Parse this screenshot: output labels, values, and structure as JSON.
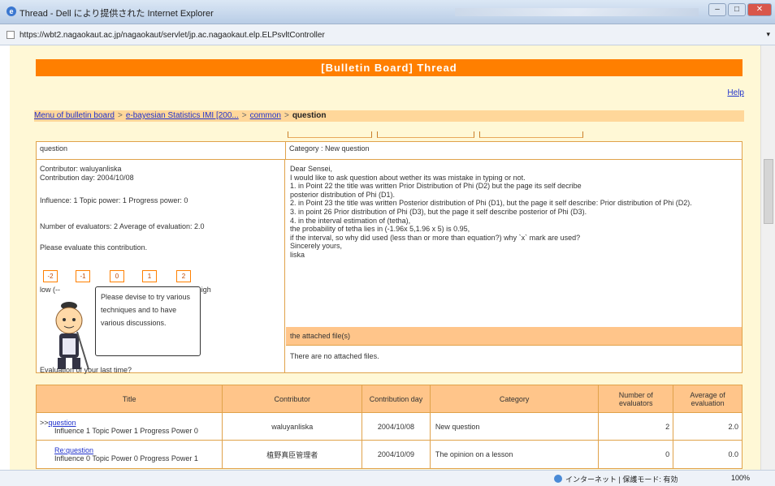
{
  "window": {
    "title": "Thread - Dell により提供された Internet Explorer",
    "url": "https://wbt2.nagaokaut.ac.jp/nagaokaut/servlet/jp.ac.nagaokaut.elp.ELPsvltController"
  },
  "banner": "[Bulletin Board] Thread",
  "help": "Help",
  "breadcrumb": {
    "items": [
      "Menu of bulletin board",
      "e-bayesian Statistics IMI [200...",
      "common"
    ],
    "current": "question"
  },
  "post": {
    "title": "question",
    "category": "Category : New question",
    "contributor": "Contributor: waluyanliska",
    "day": "Contribution day: 2004/10/08",
    "influence": "Influence: 1    Topic power: 1 Progress power: 0",
    "evaluators": "Number of evaluators: 2    Average of evaluation: 2.0",
    "evaluate_prompt": "Please evaluate this contribution.",
    "eval_buttons": [
      "-2",
      "-1",
      "0",
      "1",
      "2"
    ],
    "low": "low (--",
    "high": "--> high",
    "tip": "Please devise to try various techniques and to have various discussions.",
    "last_time": "Evaluation of your last time?",
    "body": [
      "Dear Sensei,",
      "I would like to ask question about wether its was mistake in typing or not.",
      "1. in Point 22 the title was written Prior Distribution of Phi (D2) but the page its self decribe",
      "posterior distribution of Phi (D1).",
      "2. in Point 23 the title was written Posterior distribution of Phi (D1), but the page it self describe: Prior distribution of Phi (D2).",
      "3. in point 26 Prior distribution of Phi (D3), but the page it self describe posterior of Phi (D3).",
      "4. in the interval estimation of (tetha),",
      "the probability of tetha lies in (-1.96x 5,1.96 x 5) is 0.95,",
      "if the interval, so why did used (less than or more than equation?) why `x` mark are used?",
      "Sincerely yours,",
      "liska"
    ],
    "attached_header": "the attached file(s)",
    "attached_text": "There are no attached files."
  },
  "list": {
    "headers": [
      "Title",
      "Contributor",
      "Contribution day",
      "Category",
      "Number of evaluators",
      "Average of evaluation"
    ],
    "rows": [
      {
        "prefix": ">>",
        "title": "question",
        "sub": "Influence 1   Topic Power 1   Progress Power 0",
        "contributor": "waluyanliska",
        "day": "2004/10/08",
        "category": "New question",
        "num": "2",
        "avg": "2.0"
      },
      {
        "prefix": "",
        "title": "Re:question",
        "sub": "Influence 0   Topic Power 0   Progress Power 1",
        "contributor": "植野真臣管理者",
        "day": "2004/10/09",
        "category": "The opinion on a lesson",
        "num": "0",
        "avg": "0.0"
      }
    ]
  },
  "status": {
    "zone": "インターネット | 保護モード: 有効",
    "zoom": "100%"
  }
}
